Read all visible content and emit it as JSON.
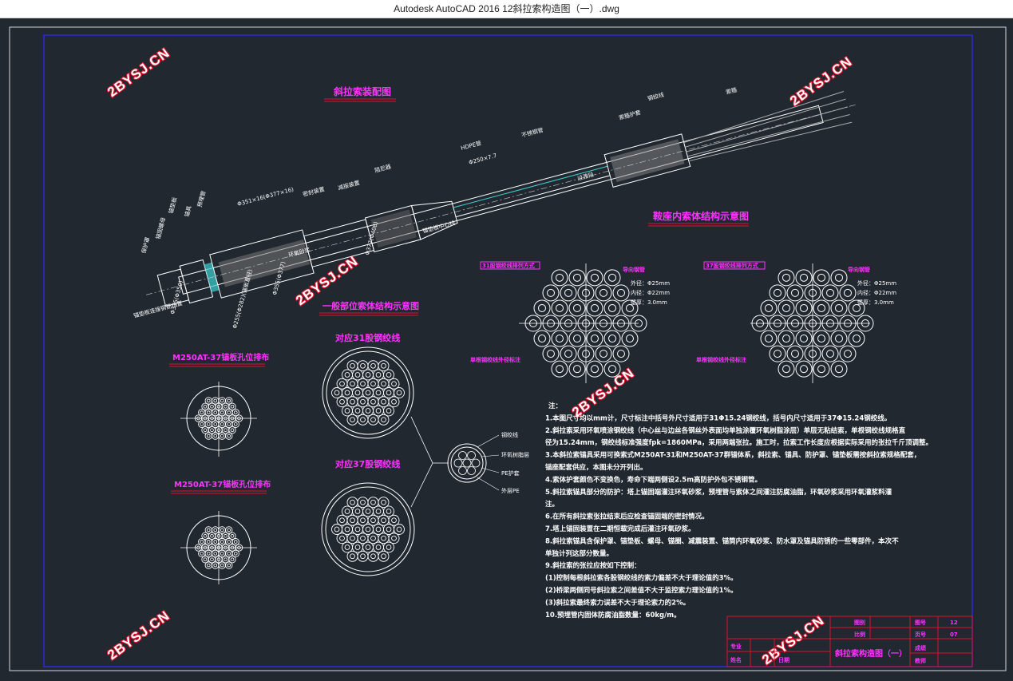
{
  "window": {
    "title": "Autodesk AutoCAD 2016    12斜拉索构造图（一）.dwg"
  },
  "colors": {
    "background": "#212830",
    "frame": "#2a2ad0",
    "heading": "#ff33ff",
    "line": "#ffffff",
    "accent_red": "#e0102a",
    "cyan": "#3fd0d0"
  },
  "watermark": "2BYSJ.CN",
  "headings": {
    "assembly": "斜拉索装配图",
    "saddle": "鞍座内索体结构示意图",
    "general": "一般部位索体结构示意图",
    "anchor_a": "M250AT-37锚板孔位排布",
    "anchor_b": "M250AT-37锚板孔位排布",
    "strand31": "对应31股钢绞线",
    "strand37": "对应37股钢绞线"
  },
  "assembly_labels": {
    "cover": "保护罩",
    "nut": "锚固螺母",
    "plate": "锚垫板",
    "anchor": "锚具",
    "pipe": "预埋管",
    "dim_pipe": "Φ351×16(Φ377×16)",
    "seal": "密封装置",
    "sleeve": "减振装置",
    "damper": "阻尼器",
    "hdpe": "HDPE管",
    "dim_hdpe": "Φ250×7.7",
    "stainless": "不锈钢管",
    "outer_cover": "索箍护套",
    "strand": "钢绞线",
    "hoop": "索箍",
    "transition": "过渡段",
    "sand": "环氧砂浆",
    "end_marker": "锚垫板中心线",
    "dim1": "Φ315(Φ350)",
    "dim2": "Φ255(Φ282)(锚板直径)",
    "dim3": "Φ355(Φ377)",
    "dim4": "Φ377(Φ408)",
    "side_note": "锚垫板连接钢筋位置"
  },
  "saddle_labels": {
    "left_title": "31股钢绞线排列方式",
    "left_bottom": "单根钢绞线外径标注",
    "right_title": "37股钢绞线排列方式",
    "right_bottom": "单根钢绞线外径标注",
    "guide": "导向钢管",
    "spec1": "外径：Φ25mm",
    "spec2": "内径：Φ22mm",
    "spec3": "壁厚：3.0mm"
  },
  "cross_labels": [
    "钢绞线",
    "环氧树脂层",
    "PE护套",
    "外层PE"
  ],
  "notes": [
    "注：",
    "1.本图尺寸均以mm计，尺寸标注中括号外尺寸适用于31Φ15.24钢绞线，括号内尺寸适用于37Φ15.24钢绞线。",
    "2.斜拉索采用环氧喷涂钢绞线（中心丝与边丝各钢丝外表面均单独涂覆环氧树脂涂层）单层无粘结索，单根钢绞线规格直",
    "径为15.24mm，钢绞线标准强度fpk=1860MPa，采用两端张拉。施工时，拉索工作长度应根据实际采用的张拉千斤顶调整。",
    "3.本斜拉索锚具采用可换索式M250AT-31和M250AT-37群锚体系，斜拉索、锚具、防护罩、锚垫板需按斜拉索规格配套，",
    "锚座配套供应，本图未分开列出。",
    "4.索体护套颜色不变换色，寿命下端两侧设2.5m高防护外包不锈钢管。",
    "5.斜拉索锚具部分的防护：塔上锚固端灌注环氧砂浆，预埋管与索体之间灌注防腐油脂，环氧砂浆采用环氧灌浆料灌",
    "注。",
    "6.在所有斜拉索张拉结束后应检查锚固端的密封情况。",
    "7.塔上锚固装置在二期恒载完成后灌注环氧砂浆。",
    "8.斜拉索锚具含保护罩、锚垫板、螺母、锚圈、减震装置、锚筒内环氧砂浆、防水罩及锚具防锈的一些零部件，本次不",
    "单独计列这部分数量。",
    "9.斜拉索的张拉应按如下控制：",
    "(1)控制每根斜拉索各股钢绞线的索力偏差不大于理论值的3%。",
    "(2)桥梁两侧同号斜拉索之间差值不大于监控索力理论值的1%。",
    "(3)斜拉索最终索力误差不大于理论索力的2%。",
    "10.预埋管内固体防腐油脂数量：60kg/m。"
  ],
  "title_block": {
    "drawing_title": "斜拉索构造图（一）",
    "k_drawno": "图号",
    "v_drawno": "12",
    "k_sheet": "页号",
    "v_sheet": "07",
    "k_scale": "比例",
    "k_figure": "图别",
    "k_major": "专业",
    "k_name": "姓名",
    "k_date": "日期",
    "k_grade": "成绩",
    "k_teacher": "教师"
  }
}
